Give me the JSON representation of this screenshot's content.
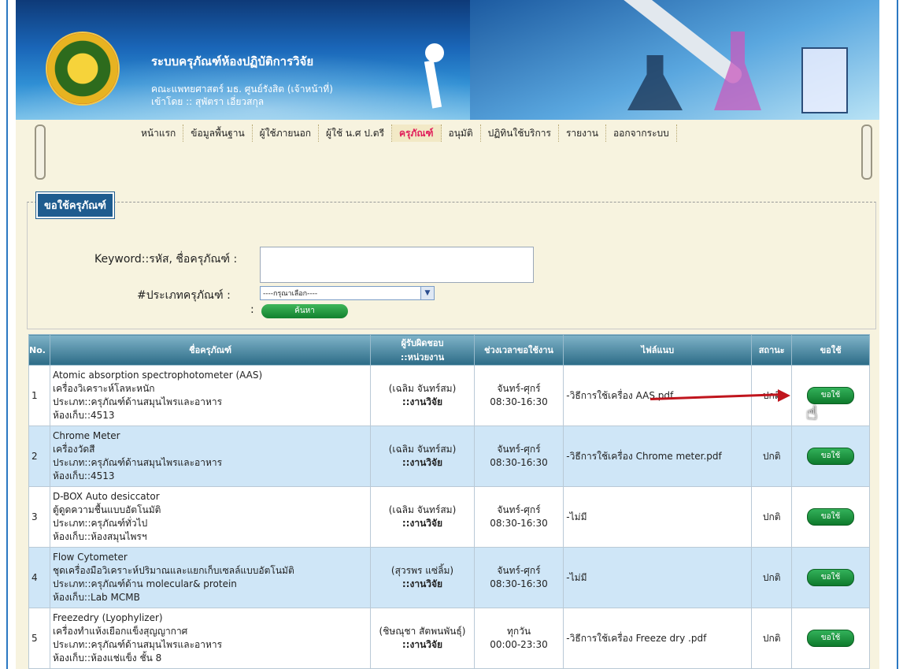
{
  "header": {
    "title": "ระบบครุภัณฑ์ห้องปฏิบัติการวิจัย",
    "subtitle": "คณะแพทยศาสตร์ มธ. ศูนย์รังสิต (เจ้าหน้าที่)",
    "login": "เข้าโดย :: สุพัตรา เอี่ยวสกุล"
  },
  "nav": [
    "หน้าแรก",
    "ข้อมูลพื้นฐาน",
    "ผู้ใช้ภายนอก",
    "ผู้ใช้ น.ศ ป.ตรี",
    "ครุภัณฑ์",
    "อนุมัติ",
    "ปฏิทินใช้บริการ",
    "รายงาน",
    "ออกจากระบบ"
  ],
  "nav_active": "ครุภัณฑ์",
  "search": {
    "legend": "ขอใช้ครุภัณฑ์",
    "keyword_label": "Keyword::รหัส, ชื่อครุภัณฑ์ :",
    "keyword_value": "",
    "type_label": "#ประเภทครุภัณฑ์ :",
    "type_value": "----กรุณาเลือก----",
    "colon": ":",
    "button": "ค้นหา"
  },
  "table": {
    "headers": {
      "no": "No.",
      "name": "ชื่อครุภัณฑ์",
      "resp1": "ผู้รับผิดชอบ",
      "resp2": "::หน่วยงาน",
      "time": "ช่วงเวลาขอใช้งาน",
      "file": "ไฟล์แนบ",
      "status": "สถานะ",
      "request": "ขอใช้"
    },
    "rows": [
      {
        "no": "1",
        "name": "Atomic absorption spectrophotometer (AAS)",
        "desc": "เครื่องวิเคราะห์โลหะหนัก",
        "type": "ประเภท::ครุภัณฑ์ด้านสมุนไพรและอาหาร",
        "room": "ห้องเก็บ::4513",
        "person": "(เฉลิม จันทร์สม)",
        "unit": "::งานวิจัย",
        "days": "จันทร์-ศุกร์",
        "hours": "08:30-16:30",
        "file": "-วิธีการใช้เครื่อง AAS.pdf",
        "status": "ปกติ",
        "btn": "ขอใช้"
      },
      {
        "no": "2",
        "name": "Chrome Meter",
        "desc": "เครื่องวัดสี",
        "type": "ประเภท::ครุภัณฑ์ด้านสมุนไพรและอาหาร",
        "room": "ห้องเก็บ::4513",
        "person": "(เฉลิม จันทร์สม)",
        "unit": "::งานวิจัย",
        "days": "จันทร์-ศุกร์",
        "hours": "08:30-16:30",
        "file": "-วิธีการใช้เครื่อง Chrome meter.pdf",
        "status": "ปกติ",
        "btn": "ขอใช้"
      },
      {
        "no": "3",
        "name": "D-BOX Auto desiccator",
        "desc": "ตู้ดูดความชื้นแบบอัตโนมัติ",
        "type": "ประเภท::ครุภัณฑ์ทั่วไป",
        "room": "ห้องเก็บ::ห้องสมุนไพรฯ",
        "person": "(เฉลิม จันทร์สม)",
        "unit": "::งานวิจัย",
        "days": "จันทร์-ศุกร์",
        "hours": "08:30-16:30",
        "file": "-ไม่มี",
        "status": "ปกติ",
        "btn": "ขอใช้"
      },
      {
        "no": "4",
        "name": "Flow Cytometer",
        "desc": "ชุดเครื่องมือวิเคราะห์ปริมาณและแยกเก็บเซลล์แบบอัตโนมัติ",
        "type": "ประเภท::ครุภัณฑ์ด้าน molecular& protein",
        "room": "ห้องเก็บ::Lab MCMB",
        "person": "(สุวรพร แซ่ลิ้ม)",
        "unit": "::งานวิจัย",
        "days": "จันทร์-ศุกร์",
        "hours": "08:30-16:30",
        "file": "-ไม่มี",
        "status": "ปกติ",
        "btn": "ขอใช้"
      },
      {
        "no": "5",
        "name": "Freezedry (Lyophylizer)",
        "desc": "เครื่องทำแห้งเยือกแข็งสุญญากาศ",
        "type": "ประเภท::ครุภัณฑ์ด้านสมุนไพรและอาหาร",
        "room": "ห้องเก็บ::ห้องแช่แข็ง ชั้น 8",
        "person": "(ชิษณุชา สัตพนพันธุ์)",
        "unit": "::งานวิจัย",
        "days": "ทุกวัน",
        "hours": "00:00-23:30",
        "file": "-วิธีการใช้เครื่อง Freeze dry .pdf",
        "status": "ปกติ",
        "btn": "ขอใช้"
      }
    ]
  }
}
